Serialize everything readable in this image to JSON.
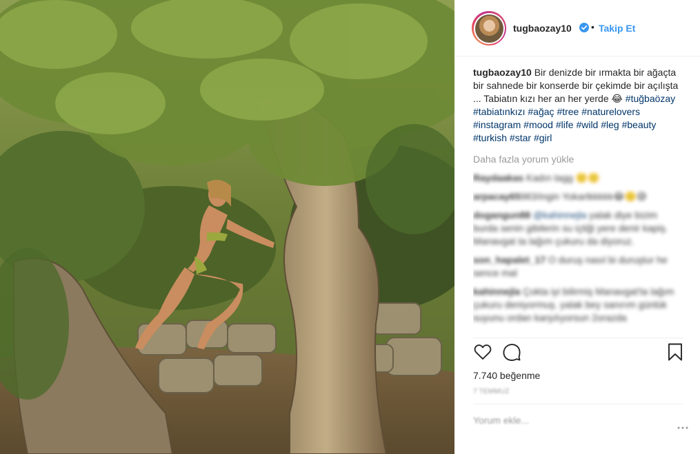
{
  "post": {
    "username": "tugbaozay10",
    "follow_label": "Takip Et",
    "separator": "•",
    "caption_user": "tugbaozay10",
    "caption_text": " Bir denizde bir ırmakta bir ağaçta bir sahnede bir konserde bir çekimde bir açılışta ... Tabiatın kızı her an her yerde 😂 ",
    "hashtags": [
      "#tuğbaözay",
      "#tabiatınkızı",
      "#ağaç",
      "#tree",
      "#naturelovers",
      "#instagram",
      "#mood",
      "#life",
      "#wild",
      "#leg",
      "#beauty",
      "#turkish",
      "#star",
      "#girl"
    ],
    "load_more_label": "Daha fazla yorum yükle",
    "likes_label": "7.740 beğenme"
  },
  "comments": [
    {
      "user": "Raydaakas",
      "mention": "",
      "text": " Kadın tagg 🙂🙂"
    },
    {
      "user": "arpacay65",
      "mention": "",
      "text": "983/ingin Yokartkkkkk😂🙂😅"
    },
    {
      "user": "dogangun88",
      "mention": "@kahinnejla",
      "text": " yalak diye bizim burda senin gibilerin su içtiği yere denir kapiş. Manavgat ta lağım çukuru da diyoruz."
    },
    {
      "user": "son_hapalet_17",
      "mention": "",
      "text": " O duruş nasıl bi duruştur he sence mal"
    },
    {
      "user": "kahinnejla",
      "mention": "",
      "text": " Çokta iyi bilirmiş Manavgat'ta lağım çukuru deniyormuş. yalak bey sanırım günlük suyunu ordan karşılıyorsun 2orazda"
    }
  ],
  "timestamp": "7 TEMMUZ",
  "add_comment_placeholder": "Yorum ekle...",
  "icons": {
    "verified": "verified-badge-icon",
    "like": "heart-icon",
    "comment": "comment-bubble-icon",
    "save": "bookmark-icon",
    "more": "more-dots-icon"
  },
  "colors": {
    "accent": "#3897f0",
    "hashtag": "#003569",
    "muted": "#999999",
    "border": "#efefef",
    "text": "#262626"
  }
}
